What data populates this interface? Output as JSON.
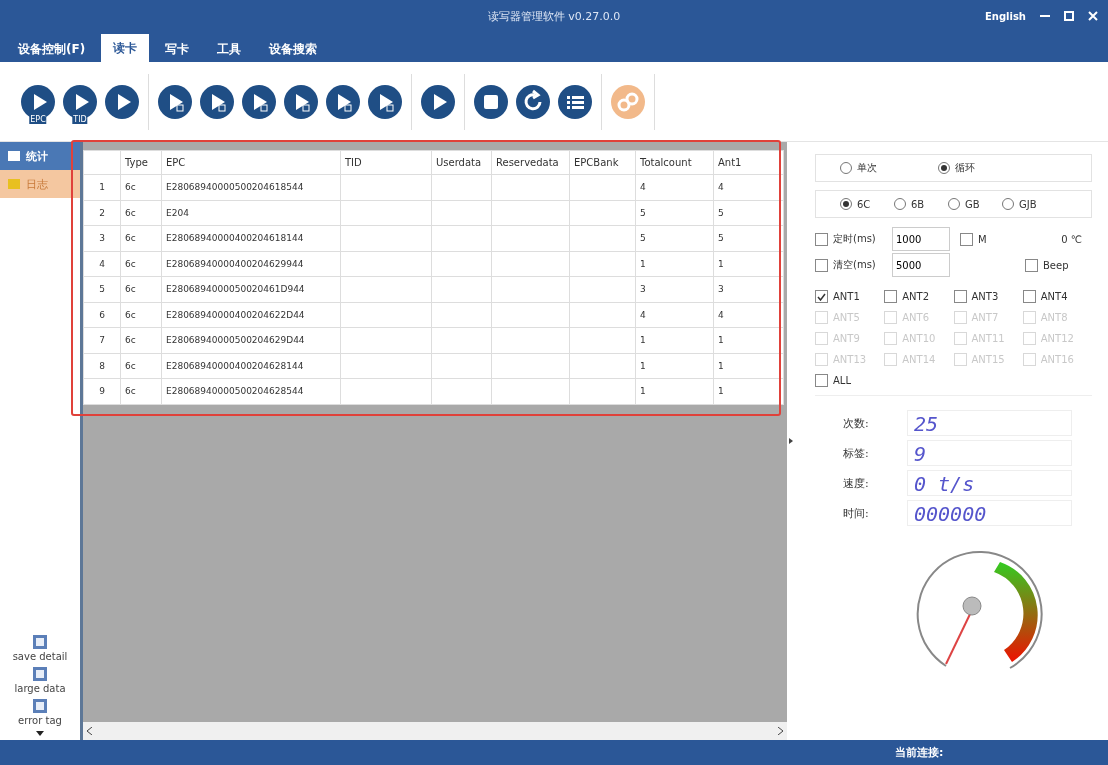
{
  "window": {
    "title": "读写器管理软件 v0.27.0.0",
    "language": "English"
  },
  "menu": [
    {
      "label": "设备控制(F)",
      "selected": false
    },
    {
      "label": "读卡",
      "selected": true
    },
    {
      "label": "写卡",
      "selected": false
    },
    {
      "label": "工具",
      "selected": false
    },
    {
      "label": "设备搜索",
      "selected": false
    }
  ],
  "toolbar": [
    [
      {
        "kind": "play",
        "badge": "EPC"
      },
      {
        "kind": "play",
        "badge": "TID"
      },
      {
        "kind": "play"
      }
    ],
    [
      {
        "kind": "play-sub"
      },
      {
        "kind": "play-sub"
      },
      {
        "kind": "play-sub"
      },
      {
        "kind": "play-sub"
      },
      {
        "kind": "play-sub"
      },
      {
        "kind": "play-sub"
      }
    ],
    [
      {
        "kind": "play"
      }
    ],
    [
      {
        "kind": "stop"
      },
      {
        "kind": "refresh"
      },
      {
        "kind": "list"
      }
    ],
    [
      {
        "kind": "link"
      }
    ]
  ],
  "sidebar": {
    "items": [
      {
        "label": "统计",
        "selected": true
      },
      {
        "label": "日志",
        "selected": false
      }
    ],
    "options": [
      {
        "label": "save detail",
        "checked": false
      },
      {
        "label": "large data",
        "checked": false
      },
      {
        "label": "error tag",
        "checked": false
      }
    ]
  },
  "table": {
    "columns": [
      "",
      "Type",
      "EPC",
      "TID",
      "Userdata",
      "Reservedata",
      "EPCBank",
      "Totalcount",
      "Ant1"
    ],
    "rows": [
      [
        "1",
        "6c",
        "E28068940000500204618544",
        "",
        "",
        "",
        "",
        "4",
        "4"
      ],
      [
        "2",
        "6c",
        "E204",
        "",
        "",
        "",
        "",
        "5",
        "5"
      ],
      [
        "3",
        "6c",
        "E28068940000400204618144",
        "",
        "",
        "",
        "",
        "5",
        "5"
      ],
      [
        "4",
        "6c",
        "E28068940000400204629944",
        "",
        "",
        "",
        "",
        "1",
        "1"
      ],
      [
        "5",
        "6c",
        "E2806894000050020461D944",
        "",
        "",
        "",
        "",
        "3",
        "3"
      ],
      [
        "6",
        "6c",
        "E28068940000400204622D44",
        "",
        "",
        "",
        "",
        "4",
        "4"
      ],
      [
        "7",
        "6c",
        "E28068940000500204629D44",
        "",
        "",
        "",
        "",
        "1",
        "1"
      ],
      [
        "8",
        "6c",
        "E28068940000400204628144",
        "",
        "",
        "",
        "",
        "1",
        "1"
      ],
      [
        "9",
        "6c",
        "E28068940000500204628544",
        "",
        "",
        "",
        "",
        "1",
        "1"
      ]
    ]
  },
  "settings": {
    "mode": [
      {
        "label": "单次",
        "selected": false
      },
      {
        "label": "循环",
        "selected": true
      }
    ],
    "protocol": [
      {
        "label": "6C",
        "selected": true
      },
      {
        "label": "6B",
        "selected": false
      },
      {
        "label": "GB",
        "selected": false
      },
      {
        "label": "GJB",
        "selected": false
      }
    ],
    "timer": {
      "label": "定时(ms)",
      "checked": false,
      "value": "1000"
    },
    "m": {
      "label": "M",
      "checked": false
    },
    "temperature": "0 ℃",
    "clear": {
      "label": "清空(ms)",
      "checked": false,
      "value": "5000"
    },
    "beep": {
      "label": "Beep",
      "checked": false
    },
    "antennas": [
      {
        "label": "ANT1",
        "checked": true,
        "disabled": false
      },
      {
        "label": "ANT2",
        "checked": false,
        "disabled": false
      },
      {
        "label": "ANT3",
        "checked": false,
        "disabled": false
      },
      {
        "label": "ANT4",
        "checked": false,
        "disabled": false
      },
      {
        "label": "ANT5",
        "checked": false,
        "disabled": true
      },
      {
        "label": "ANT6",
        "checked": false,
        "disabled": true
      },
      {
        "label": "ANT7",
        "checked": false,
        "disabled": true
      },
      {
        "label": "ANT8",
        "checked": false,
        "disabled": true
      },
      {
        "label": "ANT9",
        "checked": false,
        "disabled": true
      },
      {
        "label": "ANT10",
        "checked": false,
        "disabled": true
      },
      {
        "label": "ANT11",
        "checked": false,
        "disabled": true
      },
      {
        "label": "ANT12",
        "checked": false,
        "disabled": true
      },
      {
        "label": "ANT13",
        "checked": false,
        "disabled": true
      },
      {
        "label": "ANT14",
        "checked": false,
        "disabled": true
      },
      {
        "label": "ANT15",
        "checked": false,
        "disabled": true
      },
      {
        "label": "ANT16",
        "checked": false,
        "disabled": true
      }
    ],
    "all": {
      "label": "ALL",
      "checked": false
    }
  },
  "stats": [
    {
      "label": "次数:",
      "value": "25"
    },
    {
      "label": "标签:",
      "value": "9"
    },
    {
      "label": "速度:",
      "value": "0 t/s"
    },
    {
      "label": "时间:",
      "value": "000000"
    }
  ],
  "status_bar": {
    "label": "当前连接:"
  }
}
